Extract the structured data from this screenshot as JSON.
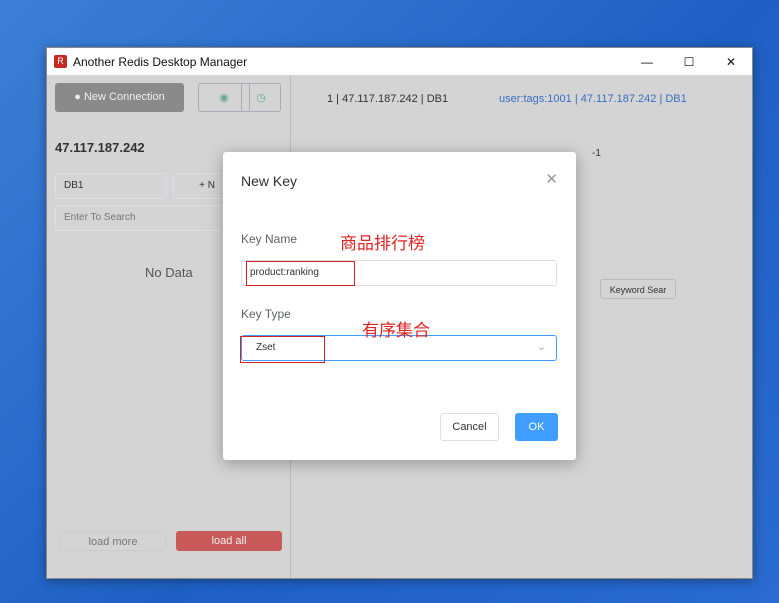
{
  "window": {
    "title": "Another Redis Desktop Manager",
    "min": "—",
    "max": "☐",
    "close": "✕"
  },
  "sidebar": {
    "new_connection": "New Connection",
    "server": "47.117.187.242",
    "db": "DB1",
    "new_key": "+ N",
    "search_placeholder": "Enter To Search",
    "no_data": "No Data",
    "load_more": "load more",
    "load_all": "load all"
  },
  "tabs": [
    {
      "label": "1 | 47.117.187.242 | DB1"
    },
    {
      "label": "user:tags:1001 | 47.117.187.242 | DB1"
    }
  ],
  "content": {
    "ttl": "-1",
    "keyword": "Keyword Sear"
  },
  "dialog": {
    "title": "New Key",
    "key_name_label": "Key Name",
    "key_name_value": "product:ranking",
    "key_type_label": "Key Type",
    "key_type_value": "Zset",
    "cancel": "Cancel",
    "ok": "OK"
  },
  "annotations": {
    "key_name": "商品排行榜",
    "key_type": "有序集合"
  }
}
